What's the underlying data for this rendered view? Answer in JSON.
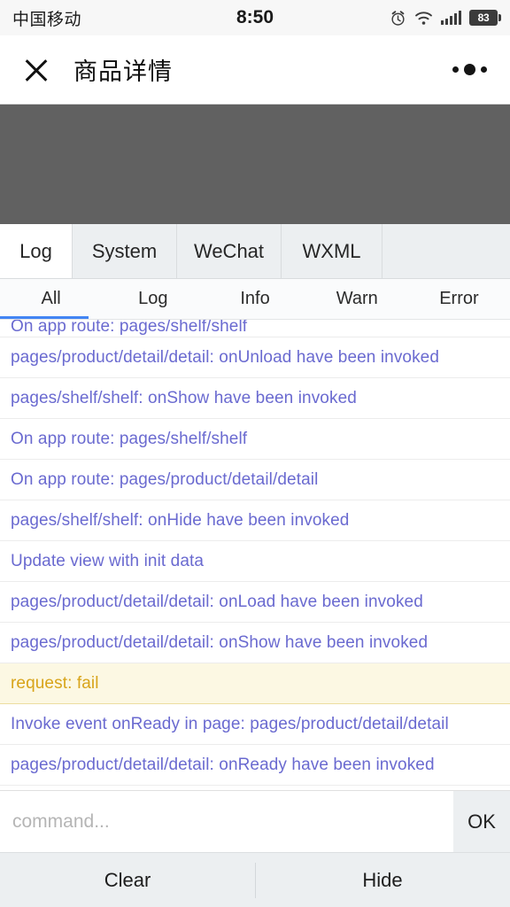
{
  "status_bar": {
    "carrier": "中国移动",
    "time": "8:50",
    "battery_level": "83",
    "icons": [
      "alarm-clock-icon",
      "wifi-icon",
      "signal-bars-icon",
      "battery-icon"
    ]
  },
  "nav_bar": {
    "close_icon": "close-icon",
    "title": "商品详情",
    "more_icon": "more-options-icon"
  },
  "console": {
    "panel_tabs": [
      {
        "label": "Log",
        "active": true
      },
      {
        "label": "System",
        "active": false
      },
      {
        "label": "WeChat",
        "active": false
      },
      {
        "label": "WXML",
        "active": false
      }
    ],
    "level_filters": [
      {
        "label": "All",
        "active": true
      },
      {
        "label": "Log",
        "active": false
      },
      {
        "label": "Info",
        "active": false
      },
      {
        "label": "Warn",
        "active": false
      },
      {
        "label": "Error",
        "active": false
      }
    ],
    "active_filter_color": "#4285f4",
    "log_text_color": "#6a6ad0",
    "warn_text_color": "#d8a41a",
    "warn_row_background": "#fcf8e3",
    "entries": [
      {
        "text": "On app route: pages/shelf/shelf",
        "level": "log",
        "clipped": true
      },
      {
        "text": "pages/product/detail/detail: onUnload have been invoked",
        "level": "log"
      },
      {
        "text": "pages/shelf/shelf: onShow have been invoked",
        "level": "log"
      },
      {
        "text": "On app route: pages/shelf/shelf",
        "level": "log"
      },
      {
        "text": "On app route: pages/product/detail/detail",
        "level": "log"
      },
      {
        "text": "pages/shelf/shelf: onHide have been invoked",
        "level": "log"
      },
      {
        "text": "Update view with init data",
        "level": "log"
      },
      {
        "text": "pages/product/detail/detail: onLoad have been invoked",
        "level": "log"
      },
      {
        "text": "pages/product/detail/detail: onShow have been invoked",
        "level": "log"
      },
      {
        "text": "request: fail",
        "level": "warn"
      },
      {
        "text": "Invoke event onReady in page: pages/product/detail/detail",
        "level": "log"
      },
      {
        "text": "pages/product/detail/detail: onReady have been invoked",
        "level": "log"
      }
    ],
    "command": {
      "value": "",
      "placeholder": "command..."
    },
    "ok_label": "OK",
    "actions": [
      {
        "label": "Clear"
      },
      {
        "label": "Hide"
      }
    ]
  }
}
